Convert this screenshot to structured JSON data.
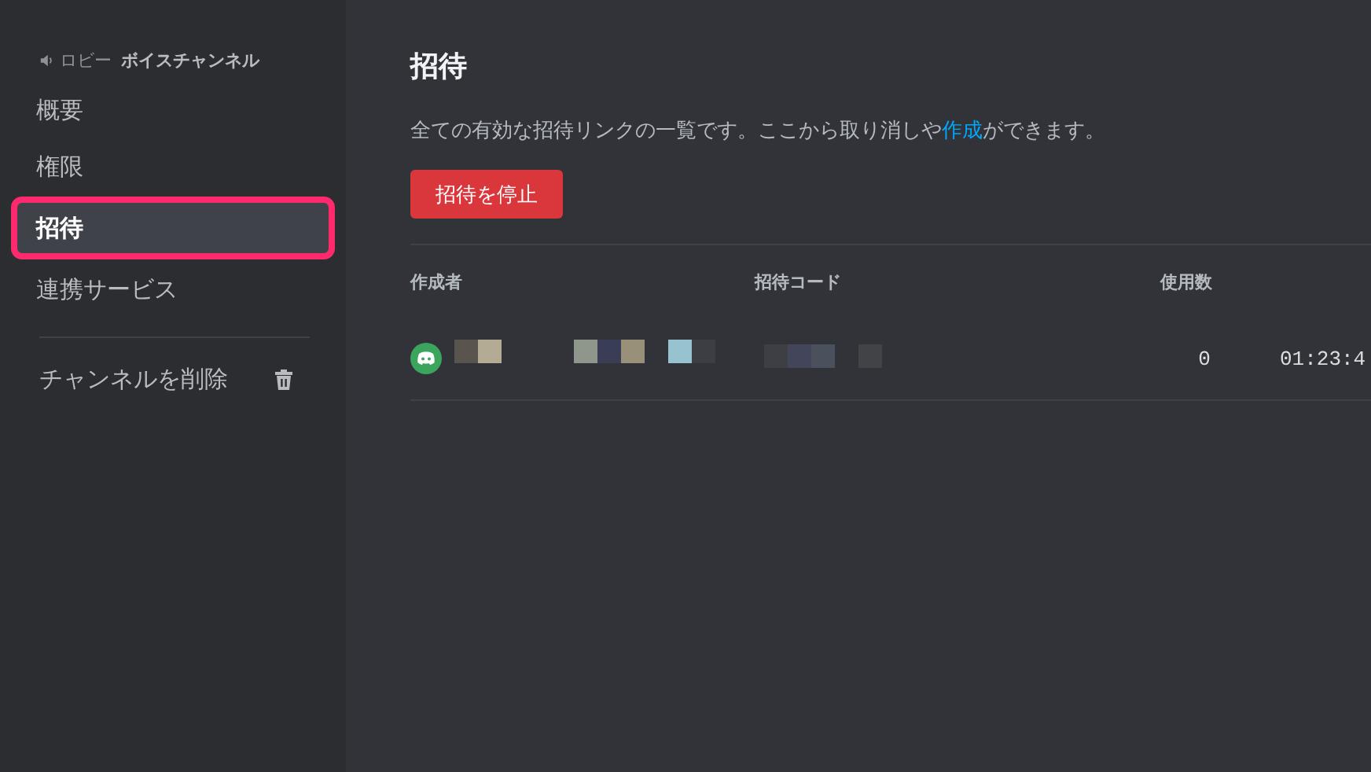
{
  "sidebar": {
    "header": {
      "category": "ロビー",
      "channel": "ボイスチャンネル"
    },
    "items": [
      {
        "label": "概要",
        "selected": false
      },
      {
        "label": "権限",
        "selected": false
      },
      {
        "label": "招待",
        "selected": true
      },
      {
        "label": "連携サービス",
        "selected": false
      }
    ],
    "delete_item": {
      "label": "チャンネルを削除"
    }
  },
  "main": {
    "title": "招待",
    "description": {
      "before": "全ての有効な招待リンクの一覧です。ここから取り消しや",
      "link": "作成",
      "after": "ができます。"
    },
    "pause_button": "招待を停止",
    "table": {
      "columns": [
        "作成者",
        "招待コード",
        "使用数"
      ],
      "rows": [
        {
          "uses": "0",
          "expires": "01:23:4"
        }
      ]
    }
  }
}
